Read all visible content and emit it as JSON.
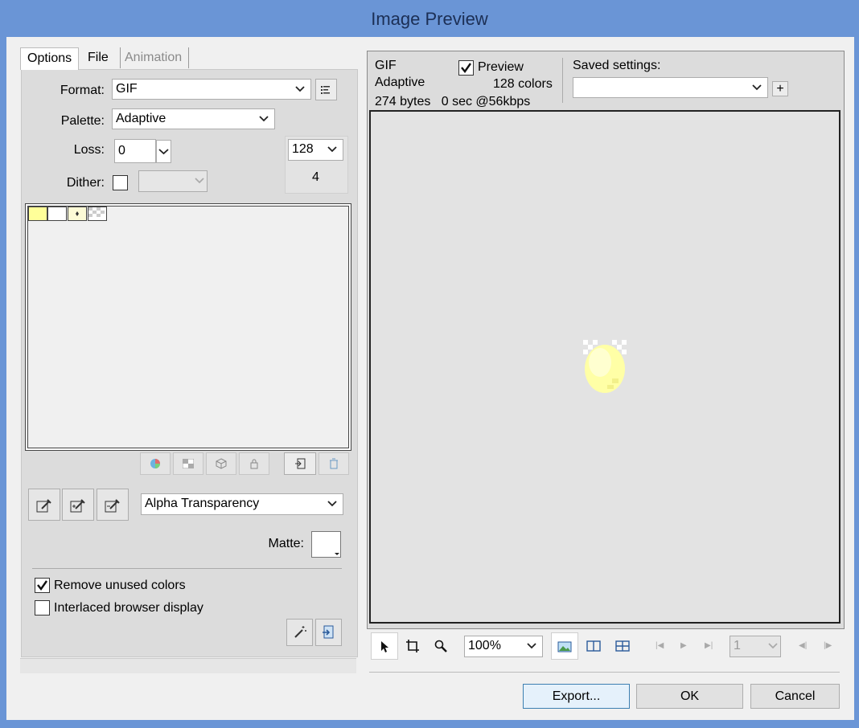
{
  "window": {
    "title": "Image Preview"
  },
  "tabs": [
    {
      "label": "Options"
    },
    {
      "label": "File"
    },
    {
      "label": "Animation"
    }
  ],
  "options": {
    "format_label": "Format:",
    "format_value": "GIF",
    "palette_label": "Palette:",
    "palette_value": "Adaptive",
    "loss_label": "Loss:",
    "loss_value": "0",
    "colors_value": "128",
    "colors_count": "4",
    "dither_label": "Dither:",
    "dither_checked": false,
    "swatch_colors": [
      "#ffff99",
      "#ffffff",
      "#fdfbd6"
    ],
    "transparency_value": "Alpha Transparency",
    "matte_label": "Matte:",
    "matte_color": "#ffffff",
    "remove_unused_label": "Remove unused colors",
    "remove_unused_checked": true,
    "interlaced_label": "Interlaced browser display",
    "interlaced_checked": false
  },
  "preview": {
    "format": "GIF",
    "palette": "Adaptive",
    "size_info": "274 bytes   0 sec @56kbps",
    "preview_label": "Preview",
    "preview_checked": true,
    "colors_info": "128 colors",
    "saved_settings_label": "Saved settings:",
    "saved_settings_value": "",
    "add_symbol": "+",
    "zoom_value": "100%",
    "frame_value": "1"
  },
  "buttons": {
    "export": "Export...",
    "ok": "OK",
    "cancel": "Cancel"
  },
  "icons": {
    "format_options": "format-options-icon",
    "pointer": "pointer-icon",
    "crop": "crop-icon",
    "zoom": "zoom-icon"
  }
}
